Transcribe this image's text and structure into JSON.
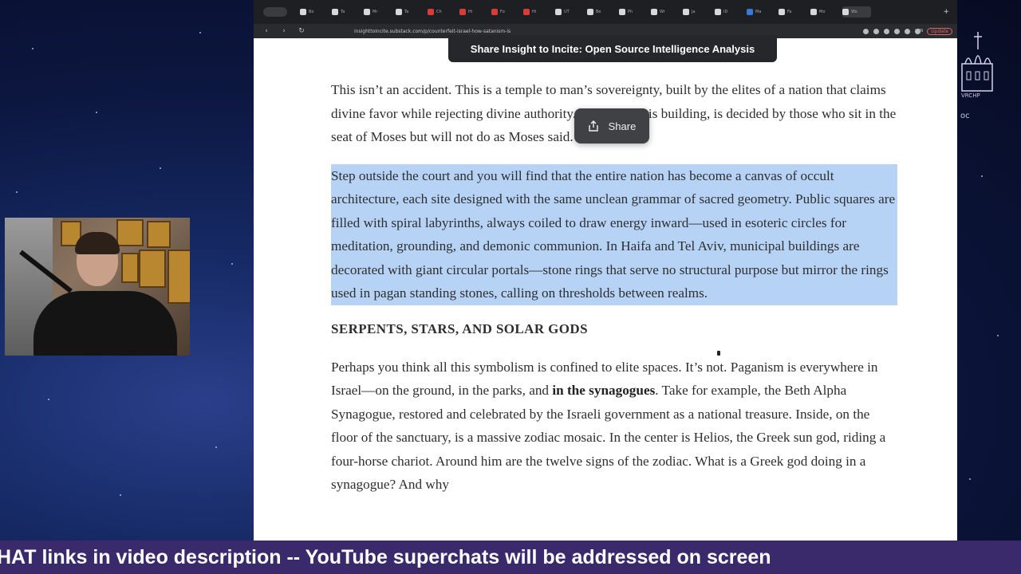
{
  "browser": {
    "url": "insighttoincite.substack.com/p/counterfeit-israel-how-satanism-is",
    "tabs": [
      "Bo",
      "Ta",
      "Mr",
      "Ta",
      "Ch",
      "Hi",
      "Fo",
      "Hi",
      "UT",
      "Be",
      "Ph",
      "Wr",
      "Ja",
      "ID",
      "Ma",
      "Fa",
      "Mo",
      "Wo"
    ],
    "vpn_label": "VPN",
    "update_label": "Update"
  },
  "share_banner": {
    "label": "Share Insight to Incite: Open Source Intelligence Analysis"
  },
  "share_popover": {
    "label": "Share",
    "icon": "share-icon"
  },
  "article": {
    "para1": "This isn’t an accident. This is a temple to man’s sovereignty, built by the elites of a nation that claims divine favor while rejecting divine authority. Justice, in this building, is decided by those who sit in the seat of Moses but will not do as Moses said.",
    "para2": "Step outside the court and you will find that the entire nation has become a canvas of occult architecture, each site designed with the same unclean grammar of sacred geometry. Public squares are filled with spiral labyrinths, always coiled to draw energy inward—used in esoteric circles for meditation, grounding, and demonic communion. In Haifa and Tel Aviv, municipal buildings are decorated with giant circular portals—stone rings that serve no structural purpose but mirror the rings used in pagan standing stones, calling on thresholds between realms.",
    "heading": "SERPENTS, STARS, AND SOLAR GODS",
    "para3_a": "Perhaps you think all this symbolism is confined to elite spaces. It’s not. Paganism is everywhere in Israel—on the ground, in the parks, and ",
    "para3_bold": "in the synagogues",
    "para3_b": ". Take for example, the Beth Alpha Synagogue, restored and celebrated by the Israeli government as a national treasure. Inside, on the floor of the sanctuary, is a massive zodiac mosaic. In the center is Helios, the Greek sun god, riding a four-horse chariot. Around him are the twelve signs of the zodiac. What is a Greek god doing in a synagogue? And why"
  },
  "logo": {
    "text": "VRCHP",
    "small": "ос"
  },
  "ticker": {
    "text": "HAT links in video description -- YouTube superchats will be addressed on screen"
  },
  "colors": {
    "highlight": "#b6d3f6",
    "ticker_bg": "#3b2a6b",
    "banner_bg": "#26272b"
  }
}
